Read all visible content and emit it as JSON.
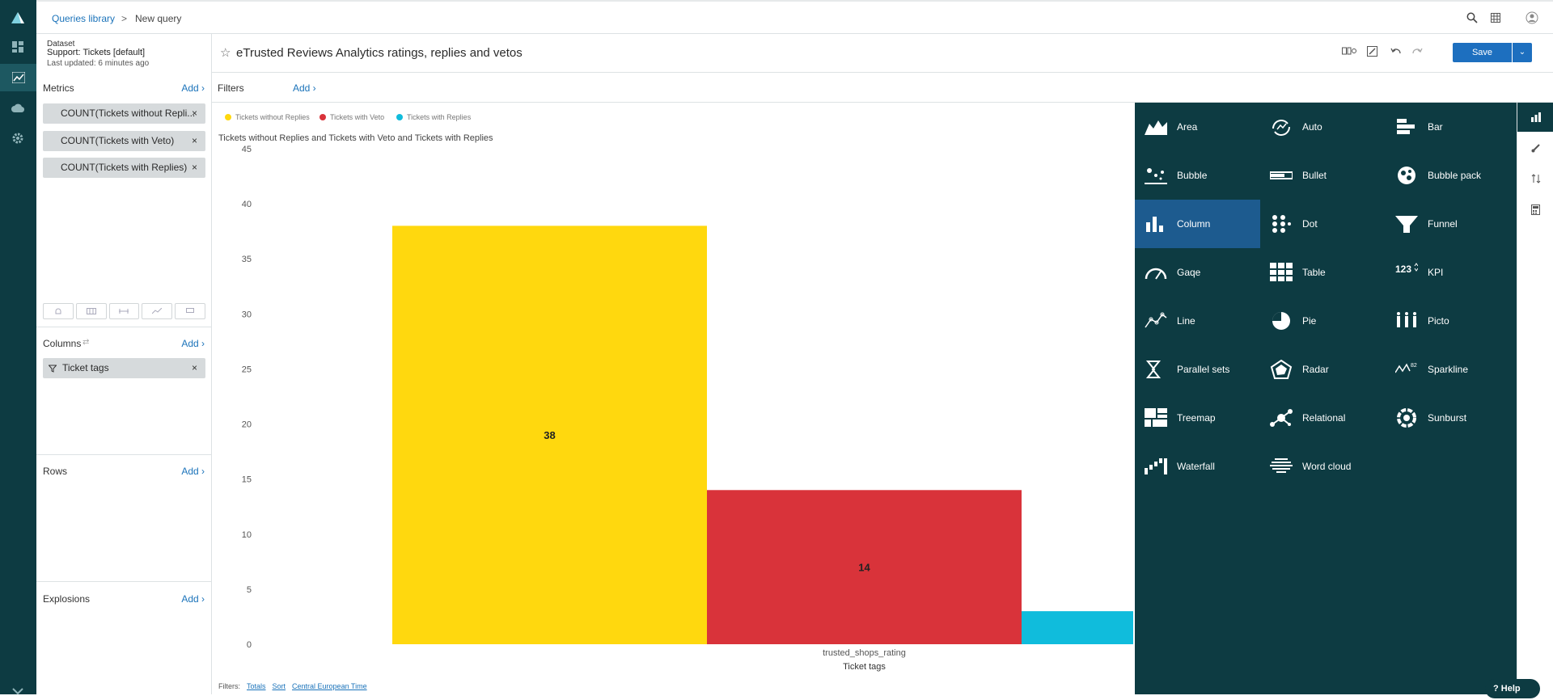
{
  "breadcrumb": {
    "library": "Queries library",
    "separator": ">",
    "current": "New query"
  },
  "dataset": {
    "label": "Dataset",
    "name": "Support: Tickets [default]",
    "updated": "Last updated: 6 minutes ago"
  },
  "query": {
    "title": "eTrusted Reviews Analytics ratings, replies and vetos",
    "save_label": "Save"
  },
  "metrics": {
    "title": "Metrics",
    "add": "Add ›",
    "items": [
      "COUNT(Tickets without Repli...",
      "COUNT(Tickets with Veto)",
      "COUNT(Tickets with Replies)"
    ],
    "remove": "×"
  },
  "columns": {
    "title": "Columns",
    "add": "Add ›",
    "items": [
      "Ticket tags"
    ]
  },
  "rows": {
    "title": "Rows",
    "add": "Add ›"
  },
  "explosions": {
    "title": "Explosions",
    "add": "Add ›"
  },
  "filters": {
    "title": "Filters",
    "add": "Add ›"
  },
  "footer": {
    "label": "Filters:",
    "totals": "Totals",
    "sort": "Sort",
    "timezone": "Central European Time"
  },
  "chart_data": {
    "type": "bar",
    "title": "Tickets without Replies and Tickets with Veto and Tickets with Replies",
    "xlabel": "Ticket tags",
    "ylabel": "",
    "categories": [
      "trusted_shops_rating"
    ],
    "series": [
      {
        "name": "Tickets without Replies",
        "values": [
          38
        ],
        "color": "#ffd80e",
        "label": "38"
      },
      {
        "name": "Tickets with Veto",
        "values": [
          14
        ],
        "color": "#d9333a",
        "label": "14"
      },
      {
        "name": "Tickets with Replies",
        "values": [
          3
        ],
        "color": "#10bcdc",
        "label": ""
      }
    ],
    "ylim": [
      0,
      45
    ],
    "yticks": [
      "0",
      "5",
      "10",
      "15",
      "20",
      "25",
      "30",
      "35",
      "40",
      "45"
    ],
    "legend": "top-left",
    "grid": false
  },
  "chart_types": [
    {
      "label": "Area",
      "icon": "area-icon"
    },
    {
      "label": "Auto",
      "icon": "auto-icon"
    },
    {
      "label": "Bar",
      "icon": "bar-icon"
    },
    {
      "label": "Bubble",
      "icon": "bubble-icon"
    },
    {
      "label": "Bullet",
      "icon": "bullet-icon"
    },
    {
      "label": "Bubble pack",
      "icon": "bubble-pack-icon"
    },
    {
      "label": "Column",
      "icon": "column-icon",
      "active": true
    },
    {
      "label": "Dot",
      "icon": "dot-icon"
    },
    {
      "label": "Funnel",
      "icon": "funnel-icon"
    },
    {
      "label": "Gaqe",
      "icon": "gauge-icon"
    },
    {
      "label": "Table",
      "icon": "table-icon"
    },
    {
      "label": "KPI",
      "icon": "kpi-icon"
    },
    {
      "label": "Line",
      "icon": "line-icon"
    },
    {
      "label": "Pie",
      "icon": "pie-icon"
    },
    {
      "label": "Picto",
      "icon": "picto-icon"
    },
    {
      "label": "Parallel sets",
      "icon": "parallel-sets-icon"
    },
    {
      "label": "Radar",
      "icon": "radar-icon"
    },
    {
      "label": "Sparkline",
      "icon": "sparkline-icon"
    },
    {
      "label": "Treemap",
      "icon": "treemap-icon"
    },
    {
      "label": "Relational",
      "icon": "relational-icon"
    },
    {
      "label": "Sunburst",
      "icon": "sunburst-icon"
    },
    {
      "label": "Waterfall",
      "icon": "waterfall-icon"
    },
    {
      "label": "Word cloud",
      "icon": "word-cloud-icon"
    }
  ],
  "kpi_glyph": "123",
  "sparkline_glyph": "82 12",
  "help": {
    "label": "Help"
  },
  "colors": {
    "rail": "#0d3b42",
    "accent": "#1d6fbf",
    "active_tile": "#1d5b8f"
  }
}
